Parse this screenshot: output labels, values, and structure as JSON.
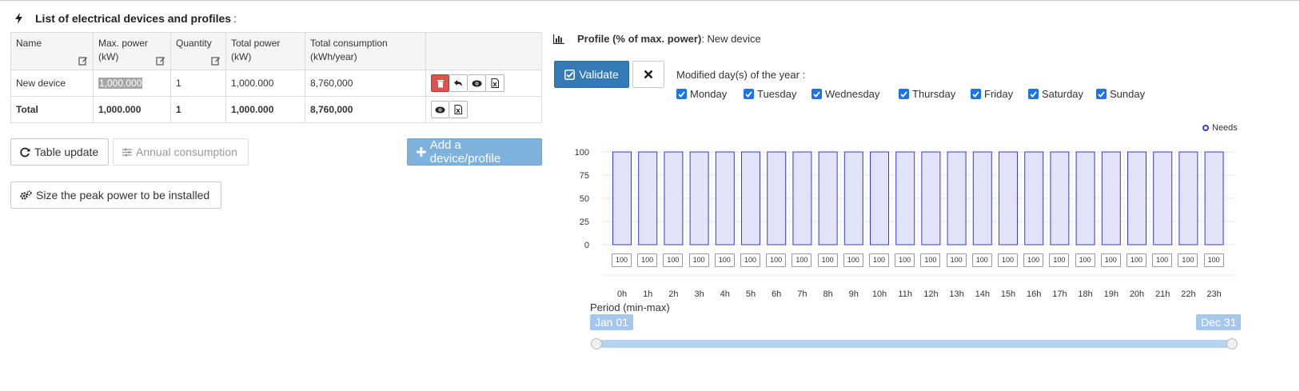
{
  "left": {
    "heading": "List of electrical devices and profiles",
    "heading_suffix": ":",
    "table": {
      "headers": {
        "name": "Name",
        "max_power": "Max. power",
        "max_power_unit": "(kW)",
        "quantity": "Quantity",
        "total_power": "Total power",
        "total_power_unit": "(kW)",
        "total_consumption": "Total consumption",
        "total_consumption_unit": "(kWh/year)"
      },
      "row": {
        "name": "New device",
        "max_power": "1,000.000",
        "quantity": "1",
        "total_power": "1,000.000",
        "total_consumption": "8,760,000"
      },
      "total": {
        "label": "Total",
        "max_power": "1,000.000",
        "quantity": "1",
        "total_power": "1,000.000",
        "total_consumption": "8,760,000"
      }
    },
    "buttons": {
      "table_update": "Table update",
      "annual_consumption": "Annual consumption",
      "add_device": "Add a device/profile",
      "size_peak": "Size the peak power to be installed"
    }
  },
  "right": {
    "title_bold": "Profile (% of max. power)",
    "title_rest": ": New device",
    "validate": "Validate",
    "modified_label": "Modified day(s) of the year :",
    "days": [
      "Monday",
      "Tuesday",
      "Wednesday",
      "Thursday",
      "Friday",
      "Saturday",
      "Sunday"
    ],
    "legend": "Needs",
    "period_label": "Period (min-max)",
    "period_start": "Jan 01",
    "period_end": "Dec 31"
  },
  "chart_data": {
    "type": "bar",
    "categories": [
      "0h",
      "1h",
      "2h",
      "3h",
      "4h",
      "5h",
      "6h",
      "7h",
      "8h",
      "9h",
      "10h",
      "11h",
      "12h",
      "13h",
      "14h",
      "15h",
      "16h",
      "17h",
      "18h",
      "19h",
      "20h",
      "21h",
      "22h",
      "23h"
    ],
    "series": [
      {
        "name": "Needs",
        "values": [
          100,
          100,
          100,
          100,
          100,
          100,
          100,
          100,
          100,
          100,
          100,
          100,
          100,
          100,
          100,
          100,
          100,
          100,
          100,
          100,
          100,
          100,
          100,
          100
        ]
      }
    ],
    "value_labels": [
      "100",
      "100",
      "100",
      "100",
      "100",
      "100",
      "100",
      "100",
      "100",
      "100",
      "100",
      "100",
      "100",
      "100",
      "100",
      "100",
      "100",
      "100",
      "100",
      "100",
      "100",
      "100",
      "100",
      "100"
    ],
    "yticks": [
      "100",
      "75",
      "50",
      "25",
      "0"
    ],
    "ylim": [
      0,
      100
    ],
    "grid": true,
    "legend_position": "top-right",
    "colors": {
      "bar_fill": "#e2e2f8",
      "bar_stroke": "#3a3ad0",
      "grid": "#e6e6e6"
    }
  }
}
